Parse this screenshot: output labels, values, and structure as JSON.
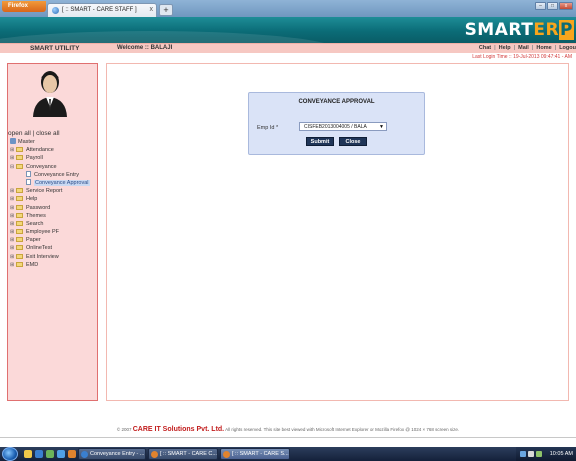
{
  "browser": {
    "menu_label": "Firefox",
    "tab_title": "[ :: SMART - CARE STAFF ]",
    "tab_close": "x",
    "newtab": "+",
    "window_buttons": {
      "minimize": "–",
      "maximize": "□",
      "close": "x"
    }
  },
  "header": {
    "brand_smart": "SMART",
    "brand_e": "E",
    "brand_r": "R",
    "brand_p": "P"
  },
  "navbar": {
    "smart_utility": "SMART UTILITY",
    "welcome": "Welcome :: BALAJI",
    "links": [
      "Chat",
      "Help",
      "Mail",
      "Home",
      "Logou"
    ],
    "last_login": "Last Login Time :: 19-Jul-2013 09:47:41 - AM"
  },
  "sidebar": {
    "open_close": "open all | close all",
    "tree": [
      {
        "label": "Master",
        "type": "root"
      },
      {
        "label": "Attendance",
        "type": "folder",
        "pm": "⊞"
      },
      {
        "label": "Payroll",
        "type": "folder",
        "pm": "⊞"
      },
      {
        "label": "Conveyance",
        "type": "folder",
        "pm": "⊟"
      },
      {
        "label": "Conveyance Entry",
        "type": "page"
      },
      {
        "label": "Conveyance Approval",
        "type": "page",
        "selected": true
      },
      {
        "label": "Service Report",
        "type": "folder",
        "pm": "⊞"
      },
      {
        "label": "Help",
        "type": "folder",
        "pm": "⊞"
      },
      {
        "label": "Password",
        "type": "folder",
        "pm": "⊞"
      },
      {
        "label": "Themes",
        "type": "folder",
        "pm": "⊞"
      },
      {
        "label": "Search",
        "type": "folder",
        "pm": "⊞"
      },
      {
        "label": "Employee PF",
        "type": "folder",
        "pm": "⊞"
      },
      {
        "label": "Paper",
        "type": "folder",
        "pm": "⊞"
      },
      {
        "label": "OnlineTest",
        "type": "folder",
        "pm": "⊞"
      },
      {
        "label": "Exit Interview",
        "type": "folder",
        "pm": "⊞"
      },
      {
        "label": "EMD",
        "type": "folder",
        "pm": "⊞"
      }
    ]
  },
  "dialog": {
    "title": "CONVEYANCE APPROVAL",
    "emp_label": "Emp Id *",
    "emp_value": "CISFEB2013004005 / BALA",
    "submit": "Submit",
    "close": "Close"
  },
  "footer": {
    "copyright": "© 2007",
    "company": "CARE IT Solutions Pvt. Ltd.",
    "rest": "All rights reserved.   This site best viewed with Microsoft Internet Explorer or Mozilla Firefox @ 1024 × 768 screen size."
  },
  "taskbar": {
    "tasks": [
      "Conveyance Entry - ...",
      "[ :: SMART - CARE C...",
      "[ :: SMART - CARE S..."
    ],
    "clock": "10:05 AM"
  }
}
